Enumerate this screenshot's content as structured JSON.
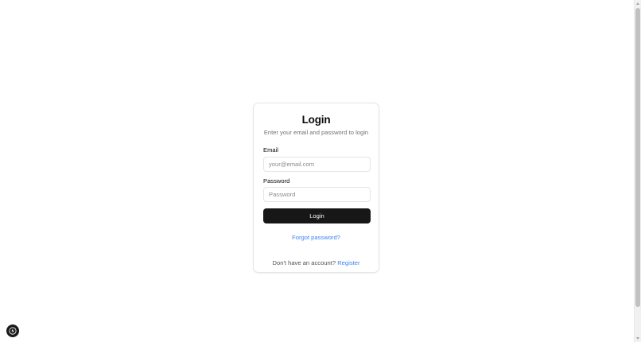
{
  "login": {
    "title": "Login",
    "subtitle": "Enter your email and password to login",
    "email_label": "Email",
    "email_placeholder": "your@email.com",
    "email_value": "",
    "password_label": "Password",
    "password_placeholder": "Password",
    "password_value": "",
    "login_button": "Login",
    "forgot_link": "Forgot password?",
    "no_account_text": "Don't have an account?",
    "register_link": "Register"
  },
  "dev_badge": {
    "icon": "lightning-bolt-icon"
  },
  "colors": {
    "primary_button": "#171717",
    "link": "#3b82f6",
    "muted_text": "#737373",
    "border": "#e5e5e5"
  }
}
